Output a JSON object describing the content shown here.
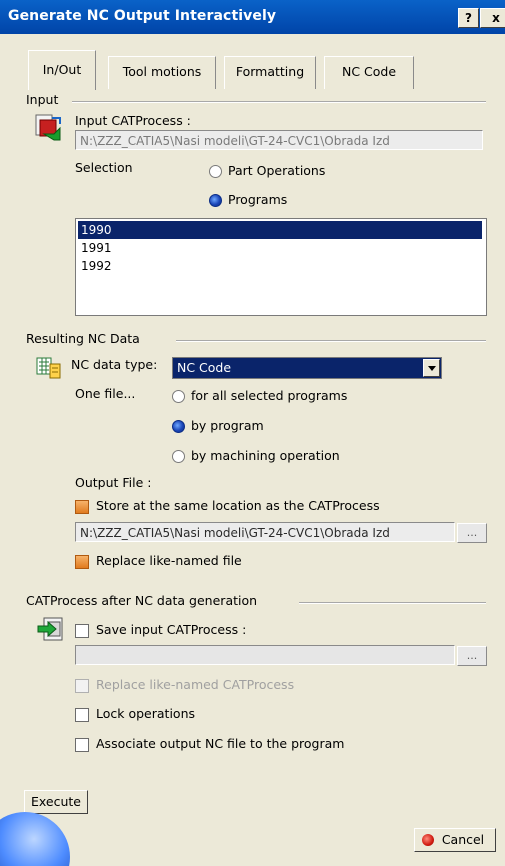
{
  "window": {
    "title": "Generate NC Output Interactively",
    "help_label": "?",
    "close_label": "x"
  },
  "tabs": [
    {
      "label": "In/Out",
      "active": true
    },
    {
      "label": "Tool motions",
      "active": false
    },
    {
      "label": "Formatting",
      "active": false
    },
    {
      "label": "NC Code",
      "active": false
    }
  ],
  "input": {
    "group_label": "Input",
    "catprocess_label": "Input CATProcess :",
    "catprocess_path": "N:\\ZZZ_CATIA5\\Nasi modeli\\GT-24-CVC1\\Obrada Izd",
    "selection_label": "Selection",
    "options": [
      {
        "label": "Part Operations",
        "checked": false
      },
      {
        "label": "Programs",
        "checked": true
      }
    ],
    "programs": [
      {
        "label": "1990",
        "selected": true
      },
      {
        "label": "1991",
        "selected": false
      },
      {
        "label": "1992",
        "selected": false
      }
    ]
  },
  "nc_data": {
    "group_label": "Resulting NC Data",
    "type_label": "NC data type:",
    "type_value": "NC Code",
    "one_file_label": "One file...",
    "one_file_options": [
      {
        "label": "for all selected programs",
        "checked": false
      },
      {
        "label": "by program",
        "checked": true
      },
      {
        "label": "by machining operation",
        "checked": false
      }
    ],
    "output_file_label": "Output File :",
    "store_same_location": {
      "label": "Store at the same location as the CATProcess",
      "checked": true
    },
    "output_path": "N:\\ZZZ_CATIA5\\Nasi modeli\\GT-24-CVC1\\Obrada Izd",
    "browse_label": "...",
    "replace_file": {
      "label": "Replace like-named file",
      "checked": true
    }
  },
  "after": {
    "group_label": "CATProcess after NC data generation",
    "save_input": {
      "label": "Save input CATProcess :",
      "checked": false
    },
    "save_path": "",
    "browse_label": "...",
    "replace_catprocess": {
      "label": "Replace like-named CATProcess",
      "checked": false,
      "disabled": true
    },
    "lock_operations": {
      "label": "Lock operations",
      "checked": false
    },
    "associate_output": {
      "label": "Associate output NC file to the program",
      "checked": false
    }
  },
  "buttons": {
    "execute": "Execute",
    "cancel": "Cancel"
  }
}
